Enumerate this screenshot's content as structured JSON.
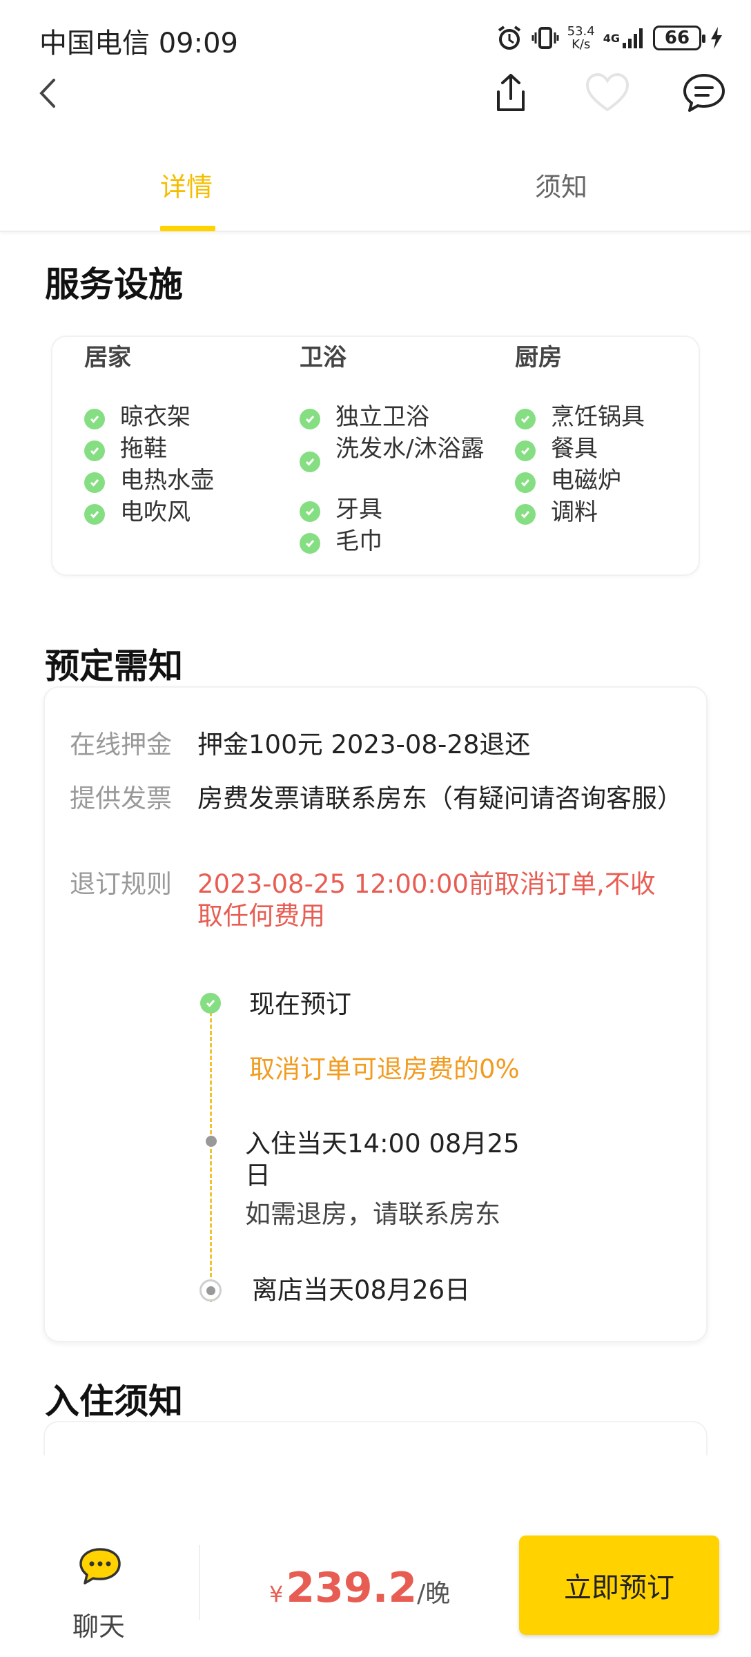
{
  "status_bar": {
    "carrier_time": "中国电信 09:09",
    "net_speed_value": "53.4",
    "net_speed_unit": "K/s",
    "network_type": "4G",
    "battery": "66"
  },
  "tabs": [
    {
      "label": "详情",
      "active": true
    },
    {
      "label": "须知",
      "active": false
    }
  ],
  "facilities": {
    "title": "服务设施",
    "groups": [
      {
        "name": "居家",
        "items": [
          "晾衣架",
          "拖鞋",
          "电热水壶",
          "电吹风"
        ]
      },
      {
        "name": "卫浴",
        "items": [
          "独立卫浴",
          "洗发水/沐浴露",
          "牙具",
          "毛巾"
        ]
      },
      {
        "name": "厨房",
        "items": [
          "烹饪锅具",
          "餐具",
          "电磁炉",
          "调料"
        ]
      }
    ]
  },
  "booking": {
    "title": "预定需知",
    "rows": [
      {
        "label": "在线押金",
        "value": "押金100元  2023-08-28退还"
      },
      {
        "label": "提供发票",
        "value": "房费发票请联系房东（有疑问请咨询客服）"
      },
      {
        "label": "退订规则",
        "value": "2023-08-25 12:00:00前取消订单,不收取任何费用"
      }
    ],
    "timeline": {
      "step1": "现在预订",
      "refund_note": "取消订单可退房费的0%",
      "step2": "入住当天14:00   08月25日",
      "step2_note": "如需退房，请联系房东",
      "step3": "离店当天08月26日"
    },
    "colors": {
      "accent": "#ffd200",
      "danger": "#e85d53",
      "orange": "#f29b1f",
      "check": "#86de83"
    }
  },
  "checkin": {
    "title": "入住须知"
  },
  "bottom": {
    "chat_label": "聊天",
    "currency": "¥",
    "price": "239.2",
    "unit": "/晚",
    "book_label": "立即预订"
  }
}
